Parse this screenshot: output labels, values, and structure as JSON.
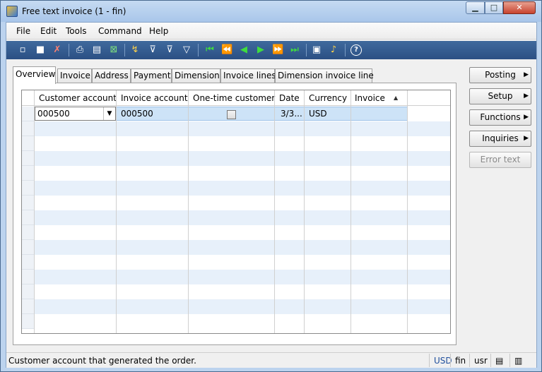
{
  "window": {
    "title": "Free text invoice (1 - fin)",
    "min_glyph": "▁",
    "max_glyph": "□",
    "close_glyph": "✕"
  },
  "menu": [
    "File",
    "Edit",
    "Tools",
    "Command",
    "Help"
  ],
  "toolbar": [
    {
      "icon": "new-icon",
      "glyph": "▫"
    },
    {
      "icon": "save-icon",
      "glyph": "■"
    },
    {
      "icon": "delete-icon",
      "glyph": "✗"
    },
    {
      "icon": "print-icon",
      "glyph": "⎙"
    },
    {
      "icon": "print-preview-icon",
      "glyph": "▤"
    },
    {
      "icon": "export-excel-icon",
      "glyph": "⊠"
    },
    {
      "icon": "go-to-main-table-icon",
      "glyph": "↯"
    },
    {
      "icon": "filter-by-selection-icon",
      "glyph": "⊽"
    },
    {
      "icon": "advanced-filter-icon",
      "glyph": "⊽"
    },
    {
      "icon": "filter-icon",
      "glyph": "▽"
    },
    {
      "icon": "first-record-icon",
      "glyph": "⏮"
    },
    {
      "icon": "previous-page-icon",
      "glyph": "⏪"
    },
    {
      "icon": "previous-record-icon",
      "glyph": "◀"
    },
    {
      "icon": "next-record-icon",
      "glyph": "▶"
    },
    {
      "icon": "next-page-icon",
      "glyph": "⏩"
    },
    {
      "icon": "last-record-icon",
      "glyph": "⏭"
    },
    {
      "icon": "document-handling-icon",
      "glyph": "▣"
    },
    {
      "icon": "alert-bell-icon",
      "glyph": "♪"
    },
    {
      "icon": "help-icon",
      "glyph": "?"
    }
  ],
  "tabs": [
    "Overview",
    "Invoice",
    "Address",
    "Payment",
    "Dimension",
    "Invoice lines",
    "Dimension invoice line"
  ],
  "grid": {
    "columns": [
      "Customer account",
      "Invoice account",
      "One-time customer",
      "Date",
      "Currency",
      "Invoice"
    ],
    "row": {
      "customer_account": "000500",
      "invoice_account": "000500",
      "one_time_customer": false,
      "date": "3/3...",
      "currency": "USD",
      "invoice": ""
    }
  },
  "buttons": [
    {
      "label": "Posting",
      "has_menu": true,
      "enabled": true
    },
    {
      "label": "Setup",
      "has_menu": true,
      "enabled": true
    },
    {
      "label": "Functions",
      "has_menu": true,
      "enabled": true
    },
    {
      "label": "Inquiries",
      "has_menu": true,
      "enabled": true
    },
    {
      "label": "Error text",
      "has_menu": false,
      "enabled": false
    }
  ],
  "status": {
    "text": "Customer account that generated the order.",
    "currency": "USD",
    "company": "fin",
    "layer": "usr"
  },
  "colors": {
    "toolbar": "#2b5084",
    "selected_row": "#cde3f7",
    "alt_row": "#e7f0fa",
    "currency_status": "#1f4e9c"
  }
}
